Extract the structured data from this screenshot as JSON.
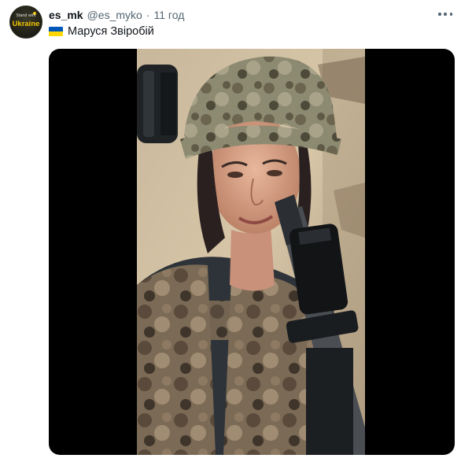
{
  "tweet": {
    "avatar": {
      "badge_small": "Stand with",
      "badge_big": "Ukraine"
    },
    "display_name": "es_mk",
    "handle": "@es_myko",
    "separator": "·",
    "time": "11 год",
    "text": "Маруся Звіробій",
    "icons": {
      "more": "more-icon",
      "flag": "ukraine-flag-icon"
    },
    "colors": {
      "badge_accent": "#f2c500",
      "flag_blue": "#0057b7",
      "flag_yellow": "#ffd700"
    }
  }
}
